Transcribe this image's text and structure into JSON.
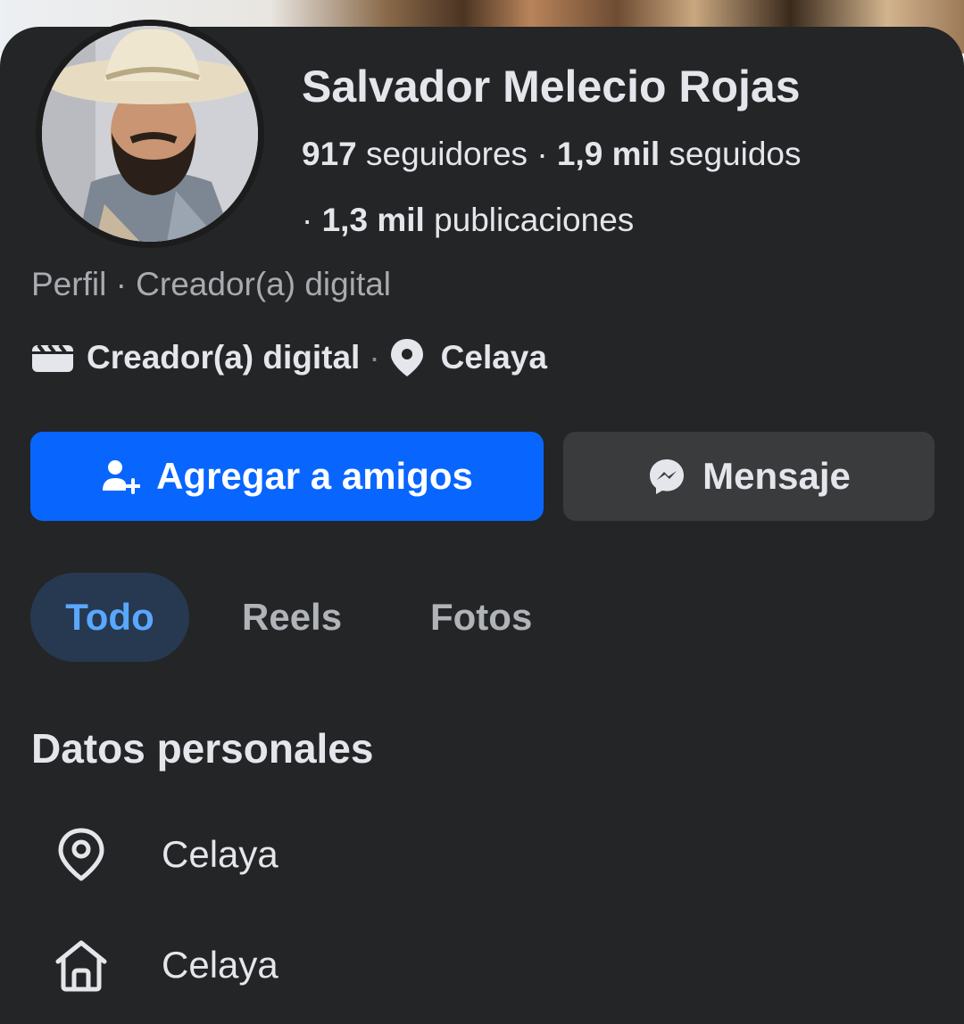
{
  "profile": {
    "name": "Salvador Melecio Rojas",
    "followers_count": "917",
    "followers_label": "seguidores",
    "following_count": "1,9 mil",
    "following_label": "seguidos",
    "posts_count": "1,3 mil",
    "posts_label": "publicaciones",
    "separator": "·",
    "subtitle": "Perfil · Creador(a) digital",
    "category": "Creador(a) digital",
    "location": "Celaya",
    "category_icon": "clapperboard-icon",
    "location_icon": "location-pin-icon"
  },
  "actions": {
    "add_friend_label": "Agregar a amigos",
    "add_friend_icon": "add-friend-icon",
    "message_label": "Mensaje",
    "message_icon": "messenger-icon"
  },
  "tabs": [
    {
      "label": "Todo",
      "active": true
    },
    {
      "label": "Reels",
      "active": false
    },
    {
      "label": "Fotos",
      "active": false
    }
  ],
  "personal_info": {
    "title": "Datos personales",
    "items": [
      {
        "icon": "location-pin-outline-icon",
        "value": "Celaya"
      },
      {
        "icon": "home-icon",
        "value": "Celaya"
      }
    ]
  },
  "colors": {
    "background": "#242526",
    "primary_button": "#0866ff",
    "secondary_button": "#3a3b3c",
    "active_tab_bg": "#263951",
    "active_tab_text": "#5aa7ff",
    "text": "#e4e6eb",
    "muted_text": "#a8abaf"
  }
}
